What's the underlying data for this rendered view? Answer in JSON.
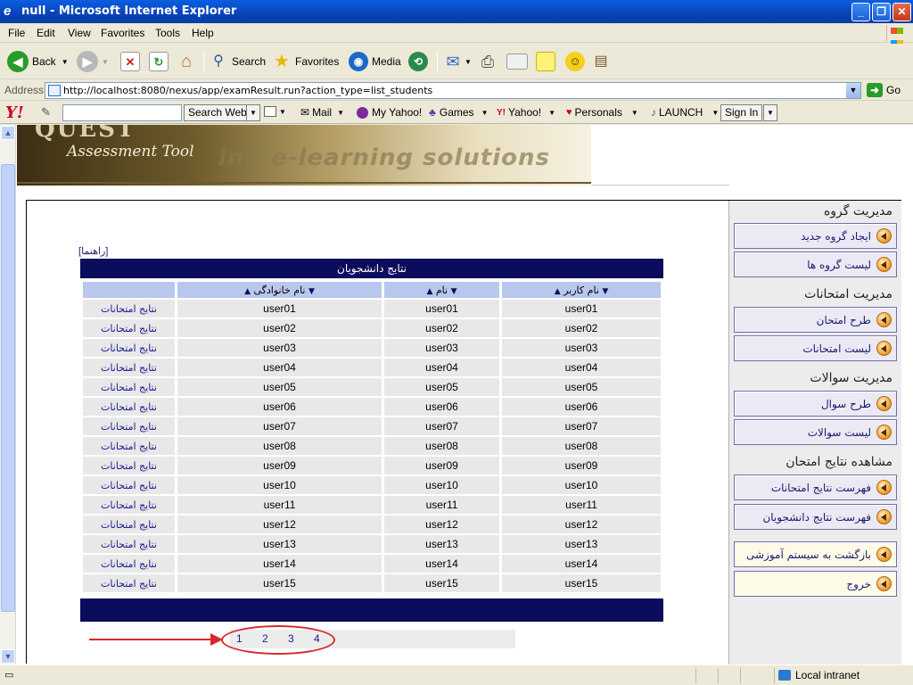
{
  "window": {
    "title": "null - Microsoft Internet Explorer",
    "icon": "ie-icon"
  },
  "menu": [
    "File",
    "Edit",
    "View",
    "Favorites",
    "Tools",
    "Help"
  ],
  "toolbar": {
    "back": "Back",
    "search": "Search",
    "favorites": "Favorites",
    "media": "Media"
  },
  "address": {
    "label": "Address",
    "url": "http://localhost:8080/nexus/app/examResult.run?action_type=list_students",
    "go": "Go"
  },
  "yahoo": {
    "search_button": "Search Web",
    "mail": "Mail",
    "my_yahoo": "My Yahoo!",
    "games": "Games",
    "yahoo": "Yahoo!",
    "personals": "Personals",
    "launch": "LAUNCH",
    "sign_in": "Sign In"
  },
  "banner": {
    "assessment": "Assessment Tool",
    "tagline": "ing e-learning solutions"
  },
  "sidebar": {
    "group_mgmt": "مدیریت گروه",
    "create_group": "ایجاد گروه جدید",
    "group_list": "لیست گروه ها",
    "exam_mgmt": "مدیریت امتحانات",
    "design_exam": "طرح امتحان",
    "exam_list": "لیست امتحانات",
    "question_mgmt": "مدیریت سوالات",
    "design_question": "طرح سوال",
    "question_list": "لیست سوالات",
    "view_results": "مشاهده نتایج امتحان",
    "exam_results_list": "فهرست نتایج امتحانات",
    "student_results_list": "فهرست نتایج دانشجویان",
    "back_to_edu": "بازگشت به سیستم آموزشی",
    "exit": "خروج"
  },
  "help_link": "[راهنما]",
  "table": {
    "title": "نتایج دانشجویان",
    "columns": [
      "نام کاربر",
      "نام",
      "نام خانوادگی",
      ""
    ],
    "row_link": "نتایج امتحانات",
    "rows": [
      [
        "user01",
        "user01",
        "user01"
      ],
      [
        "user02",
        "user02",
        "user02"
      ],
      [
        "user03",
        "user03",
        "user03"
      ],
      [
        "user04",
        "user04",
        "user04"
      ],
      [
        "user05",
        "user05",
        "user05"
      ],
      [
        "user06",
        "user06",
        "user06"
      ],
      [
        "user07",
        "user07",
        "user07"
      ],
      [
        "user08",
        "user08",
        "user08"
      ],
      [
        "user09",
        "user09",
        "user09"
      ],
      [
        "user10",
        "user10",
        "user10"
      ],
      [
        "user11",
        "user11",
        "user11"
      ],
      [
        "user12",
        "user12",
        "user12"
      ],
      [
        "user13",
        "user13",
        "user13"
      ],
      [
        "user14",
        "user14",
        "user14"
      ],
      [
        "user15",
        "user15",
        "user15"
      ]
    ]
  },
  "pager": [
    "1",
    "2",
    "3",
    "4"
  ],
  "status": {
    "zone": "Local intranet"
  },
  "colors": {
    "header_navy": "#0c0c5c",
    "annotation_red": "#d8282a"
  }
}
